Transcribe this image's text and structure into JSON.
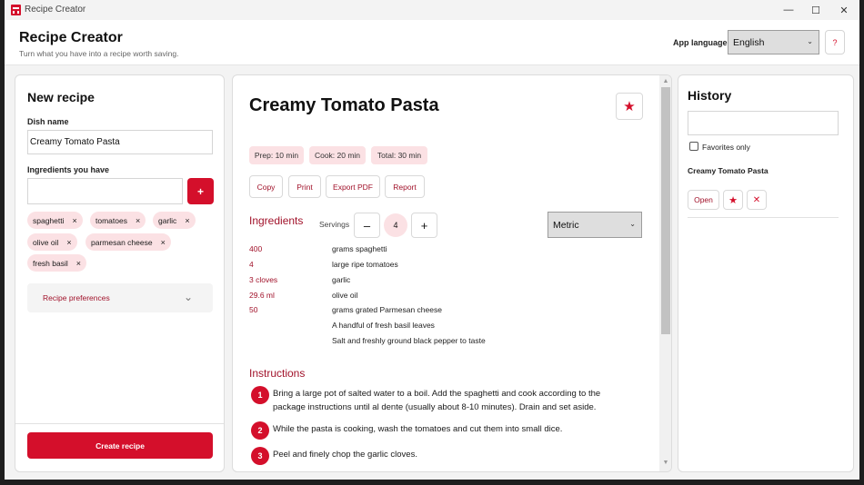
{
  "window": {
    "title": "Recipe Creator",
    "controls": {
      "minimize": "—",
      "maximize": "☐",
      "close": "✕"
    }
  },
  "header": {
    "title": "Recipe Creator",
    "subtitle": "Turn what you have into a recipe worth saving.",
    "language_label": "App language",
    "language_value": "English",
    "help_label": "?"
  },
  "left": {
    "title": "New recipe",
    "dish_label": "Dish name",
    "dish_value": "Creamy Tomato Pasta",
    "ingredients_label": "Ingredients you have",
    "ingredient_input_value": "",
    "add_label": "+",
    "chips": [
      "spaghetti",
      "tomatoes",
      "garlic",
      "olive oil",
      "parmesan cheese",
      "fresh basil"
    ],
    "chip_remove": "×",
    "prefs_label": "Recipe preferences",
    "create_label": "Create recipe"
  },
  "recipe": {
    "title": "Creamy Tomato Pasta",
    "fav_icon": "★",
    "times": [
      "Prep: 10 min",
      "Cook: 20 min",
      "Total: 30 min"
    ],
    "actions": [
      "Copy",
      "Print",
      "Export PDF",
      "Report"
    ],
    "ingredients_heading": "Ingredients",
    "servings_label": "Servings",
    "minus_label": "–",
    "plus_label": "+",
    "servings_value": "4",
    "unit_value": "Metric",
    "ingredients": [
      {
        "qty": "400",
        "name": "grams spaghetti"
      },
      {
        "qty": "4",
        "name": "large ripe tomatoes"
      },
      {
        "qty": "3 cloves",
        "name": "garlic"
      },
      {
        "qty": "29.6 ml",
        "name": "olive oil"
      },
      {
        "qty": "50",
        "name": "grams grated Parmesan cheese"
      },
      {
        "qty": "",
        "name": "A handful of fresh basil leaves"
      },
      {
        "qty": "",
        "name": "Salt and freshly ground black pepper to taste"
      }
    ],
    "instructions_heading": "Instructions",
    "steps": [
      {
        "num": "1",
        "text": "Bring a large pot of salted water to a boil. Add the spaghetti and cook according to the package instructions until al dente (usually about 8-10 minutes). Drain and set aside."
      },
      {
        "num": "2",
        "text": "While the pasta is cooking, wash the tomatoes and cut them into small dice."
      },
      {
        "num": "3",
        "text": "Peel and finely chop the garlic cloves."
      }
    ]
  },
  "history": {
    "title": "History",
    "search_value": "",
    "favorites_label": "Favorites only",
    "items": [
      {
        "title": "Creamy Tomato Pasta",
        "open_label": "Open",
        "fav_icon": "★",
        "delete_icon": "✕"
      }
    ]
  },
  "colors": {
    "accent": "#d40f2b",
    "accent_dark": "#a1122a",
    "chip_bg": "#fbe1e4"
  }
}
